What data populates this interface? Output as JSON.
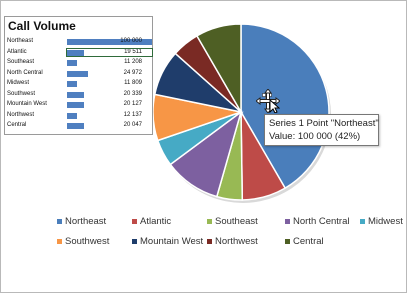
{
  "table": {
    "title": "Call Volume",
    "rows": [
      {
        "label": "Northeast",
        "value": "100 000",
        "num": 100000
      },
      {
        "label": "Atlantic",
        "value": "19 511",
        "num": 19511
      },
      {
        "label": "Southeast",
        "value": "11 208",
        "num": 11208
      },
      {
        "label": "North Central",
        "value": "24 972",
        "num": 24972
      },
      {
        "label": "Midwest",
        "value": "11 809",
        "num": 11809
      },
      {
        "label": "Southwest",
        "value": "20 339",
        "num": 20339
      },
      {
        "label": "Mountain West",
        "value": "20 127",
        "num": 20127
      },
      {
        "label": "Northwest",
        "value": "12 137",
        "num": 12137
      },
      {
        "label": "Central",
        "value": "20 047",
        "num": 20047
      }
    ],
    "selected_row": "Atlantic"
  },
  "tooltip": {
    "line1": "Series 1 Point \"Northeast\"",
    "line2": "Value:  100 000      (42%)"
  },
  "cursor": {
    "icon": "move-cursor-icon"
  },
  "chart_data": {
    "type": "pie",
    "title": "",
    "categories": [
      "Northeast",
      "Atlantic",
      "Southeast",
      "North Central",
      "Midwest",
      "Southwest",
      "Mountain West",
      "Northwest",
      "Central"
    ],
    "series": [
      {
        "values": [
          100000,
          19511,
          11208,
          24972,
          11809,
          20339,
          20127,
          12137,
          20047
        ]
      }
    ],
    "colors": [
      "#4a7ebb",
      "#be4b48",
      "#98b954",
      "#7d60a0",
      "#46aac5",
      "#f79646",
      "#1f3d6b",
      "#7a2a24",
      "#4e5f24"
    ],
    "start_angle_deg": 0,
    "direction": "clockwise",
    "legend": {
      "position": "bottom",
      "entries": [
        "Northeast",
        "Atlantic",
        "Southeast",
        "North Central",
        "Midwest",
        "Southwest",
        "Mountain West",
        "Northwest",
        "Central"
      ]
    }
  }
}
